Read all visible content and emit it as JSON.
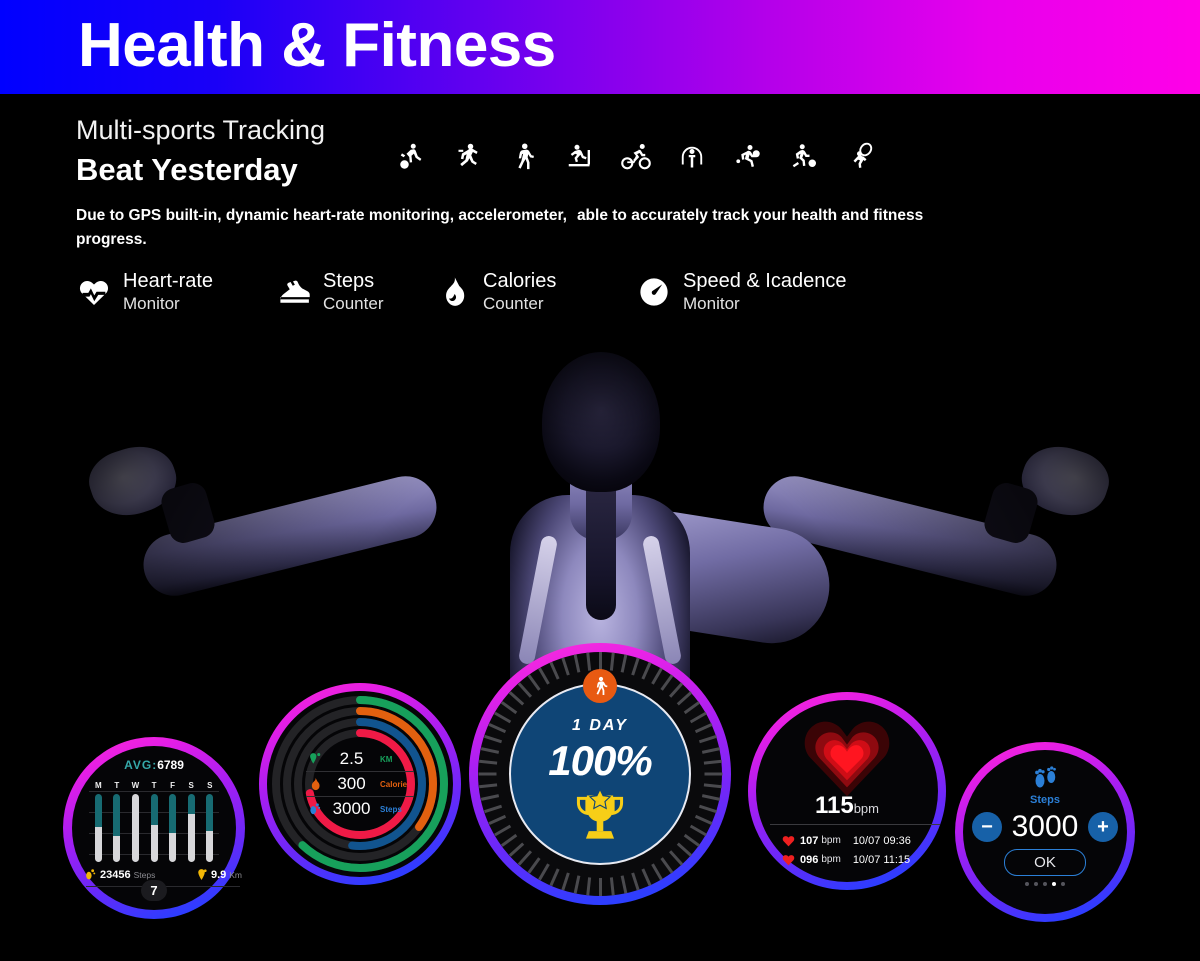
{
  "header": {
    "title": "Health & Fitness",
    "gradient_from": "#0000ff",
    "gradient_to": "#ff00e8"
  },
  "intro": {
    "kicker": "Multi-sports Tracking",
    "headline": "Beat Yesterday",
    "description_part1": "Due to GPS built-in, dynamic heart-rate monitoring, accelerometer,",
    "description_part2": "able to accurately track your health and fitness progress."
  },
  "sports": [
    {
      "name": "basketball",
      "color": "#3a3a3c"
    },
    {
      "name": "running",
      "color": "#e2600f"
    },
    {
      "name": "walking",
      "color": "#0f8a55"
    },
    {
      "name": "treadmill",
      "color": "#e5133f"
    },
    {
      "name": "cycling",
      "color": "#10457e"
    },
    {
      "name": "jump-rope",
      "color": "#0f6f73"
    },
    {
      "name": "table-tennis",
      "color": "#e5133f"
    },
    {
      "name": "football",
      "color": "#3a3a3c"
    },
    {
      "name": "badminton",
      "color": "#0f8a55"
    }
  ],
  "features": [
    {
      "icon": "heart-pulse-icon",
      "title": "Heart-rate",
      "subtitle": "Monitor"
    },
    {
      "icon": "sneaker-icon",
      "title": "Steps",
      "subtitle": "Counter"
    },
    {
      "icon": "flame-icon",
      "title": "Calories",
      "subtitle": "Counter"
    },
    {
      "icon": "speedometer-icon",
      "title": "Speed & Icadence",
      "subtitle": "Monitor"
    }
  ],
  "watches": {
    "steps_week": {
      "avg_label": "AVG:",
      "avg_value": "6789",
      "days": [
        "M",
        "T",
        "W",
        "T",
        "F",
        "S",
        "S"
      ],
      "bars": [
        {
          "day": "M",
          "teal_pct": 48,
          "gray_pct": 52
        },
        {
          "day": "T",
          "teal_pct": 62,
          "gray_pct": 38
        },
        {
          "day": "W",
          "teal_pct": 0,
          "gray_pct": 100
        },
        {
          "day": "T",
          "teal_pct": 45,
          "gray_pct": 55
        },
        {
          "day": "F",
          "teal_pct": 58,
          "gray_pct": 42
        },
        {
          "day": "S",
          "teal_pct": 30,
          "gray_pct": 70
        },
        {
          "day": "S",
          "teal_pct": 55,
          "gray_pct": 45
        }
      ],
      "steps_value": "23456",
      "steps_unit": "Steps",
      "distance_value": "9.9",
      "distance_unit": "Km",
      "badge": "7"
    },
    "rings": {
      "rows": [
        {
          "icon": "location-pin-icon",
          "value": "2.5",
          "unit": "KM",
          "color": "#17a05b"
        },
        {
          "icon": "flame-icon",
          "value": "300",
          "unit": "Calorie",
          "color": "#e2600f"
        },
        {
          "icon": "footprint-icon",
          "value": "3000",
          "unit": "Steps",
          "color": "#2b7fd6"
        }
      ],
      "ring_colors": [
        "#17a05b",
        "#e2600f",
        "#11548f",
        "#ef1a46"
      ],
      "ring_progress": [
        62,
        35,
        52,
        72
      ]
    },
    "goal": {
      "badge_icon": "walking-icon",
      "period": "1 DAY",
      "percent": "100%",
      "trophy_icon": "trophy-icon"
    },
    "heart": {
      "current_value": "115",
      "current_unit": "bpm",
      "history": [
        {
          "value": "107",
          "unit": "bpm",
          "time": "10/07 09:36"
        },
        {
          "value": "096",
          "unit": "bpm",
          "time": "10/07 11:15"
        }
      ]
    },
    "steps_goal": {
      "icon": "footprints-icon",
      "label": "Steps",
      "minus": "−",
      "plus": "+",
      "value": "3000",
      "ok": "OK",
      "dots": 5,
      "active_dot": 4
    }
  }
}
